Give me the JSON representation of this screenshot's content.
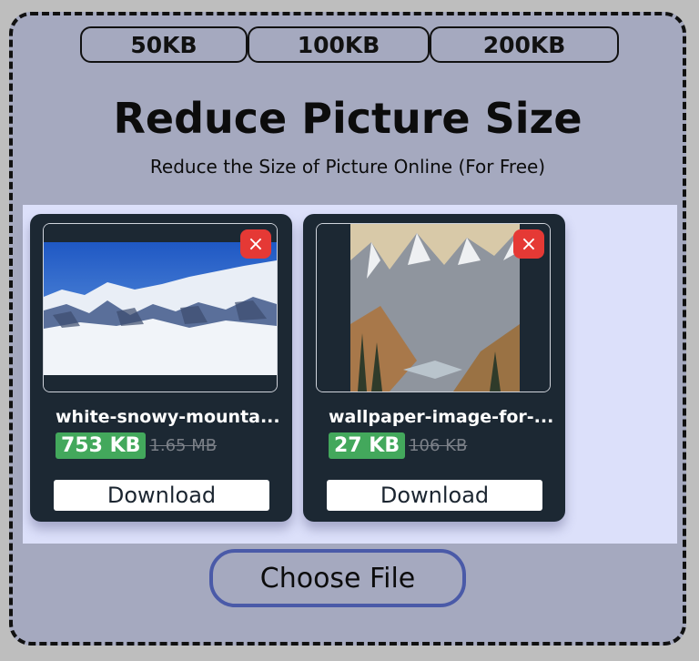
{
  "presets": [
    "50KB",
    "100KB",
    "200KB"
  ],
  "header": {
    "title": "Reduce Picture Size",
    "subtitle": "Reduce the Size of Picture Online (For Free)"
  },
  "files": [
    {
      "name": "white-snowy-mounta...",
      "compressed_size": "753 KB",
      "original_size": "1.65 MB",
      "download_label": "Download",
      "thumbnail": "snowy-mountain-landscape-photo"
    },
    {
      "name": "wallpaper-image-for-...",
      "compressed_size": "27 KB",
      "original_size": "106 KB",
      "download_label": "Download",
      "thumbnail": "painted-mountain-valley-wallpaper"
    }
  ],
  "icons": {
    "remove": "×"
  },
  "choose_file_label": "Choose File",
  "colors": {
    "background": "#a5a9bf",
    "panel": "#dce0fa",
    "card": "#1c2833",
    "remove": "#e53935",
    "badge": "#43a85c",
    "choose_border": "#4a5aa8"
  }
}
